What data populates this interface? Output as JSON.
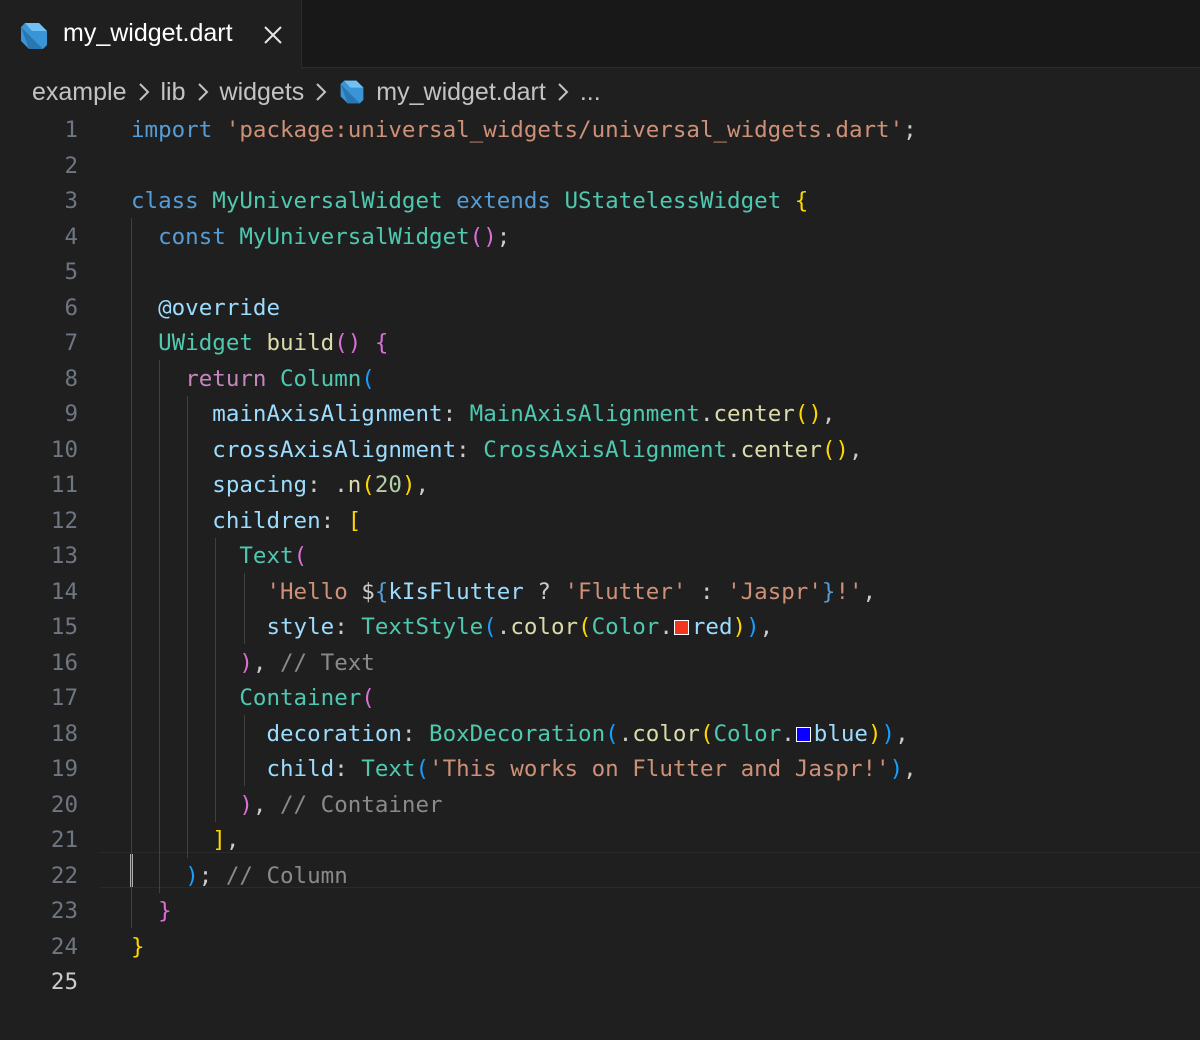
{
  "tab": {
    "label": "my_widget.dart"
  },
  "breadcrumb": {
    "items": [
      "example",
      "lib",
      "widgets",
      "my_widget.dart",
      "..."
    ]
  },
  "colors": {
    "red_swatch": "#f1351f",
    "blue_swatch": "#0b00ff"
  },
  "editor": {
    "line_numbers": [
      "1",
      "2",
      "3",
      "4",
      "5",
      "6",
      "7",
      "8",
      "9",
      "10",
      "11",
      "12",
      "13",
      "14",
      "15",
      "16",
      "17",
      "18",
      "19",
      "20",
      "21",
      "22",
      "23",
      "24",
      "25"
    ],
    "lines": [
      {
        "tokens": [
          {
            "t": "import",
            "c": "k"
          },
          {
            "t": " ",
            "c": "p"
          },
          {
            "t": "'package:universal_widgets/universal_widgets.dart'",
            "c": "s"
          },
          {
            "t": ";",
            "c": "p"
          }
        ]
      },
      {
        "tokens": []
      },
      {
        "tokens": [
          {
            "t": "class",
            "c": "k"
          },
          {
            "t": " ",
            "c": "p"
          },
          {
            "t": "MyUniversalWidget",
            "c": "t"
          },
          {
            "t": " ",
            "c": "p"
          },
          {
            "t": "extends",
            "c": "k"
          },
          {
            "t": " ",
            "c": "p"
          },
          {
            "t": "UStatelessWidget",
            "c": "t"
          },
          {
            "t": " ",
            "c": "p"
          },
          {
            "t": "{",
            "c": "b1"
          }
        ]
      },
      {
        "tokens": [
          {
            "t": "  ",
            "c": "p"
          },
          {
            "t": "const",
            "c": "k"
          },
          {
            "t": " ",
            "c": "p"
          },
          {
            "t": "MyUniversalWidget",
            "c": "t"
          },
          {
            "t": "()",
            "c": "b2"
          },
          {
            "t": ";",
            "c": "p"
          }
        ]
      },
      {
        "tokens": []
      },
      {
        "tokens": [
          {
            "t": "  ",
            "c": "p"
          },
          {
            "t": "@override",
            "c": "v"
          }
        ]
      },
      {
        "tokens": [
          {
            "t": "  ",
            "c": "p"
          },
          {
            "t": "UWidget",
            "c": "t"
          },
          {
            "t": " ",
            "c": "p"
          },
          {
            "t": "build",
            "c": "f"
          },
          {
            "t": "()",
            "c": "b2"
          },
          {
            "t": " ",
            "c": "p"
          },
          {
            "t": "{",
            "c": "b2"
          }
        ]
      },
      {
        "tokens": [
          {
            "t": "    ",
            "c": "p"
          },
          {
            "t": "return",
            "c": "kc"
          },
          {
            "t": " ",
            "c": "p"
          },
          {
            "t": "Column",
            "c": "t"
          },
          {
            "t": "(",
            "c": "b3"
          }
        ]
      },
      {
        "tokens": [
          {
            "t": "      ",
            "c": "p"
          },
          {
            "t": "mainAxisAlignment",
            "c": "v"
          },
          {
            "t": ": ",
            "c": "p"
          },
          {
            "t": "MainAxisAlignment",
            "c": "t"
          },
          {
            "t": ".",
            "c": "p"
          },
          {
            "t": "center",
            "c": "f"
          },
          {
            "t": "()",
            "c": "b1"
          },
          {
            "t": ",",
            "c": "p"
          }
        ]
      },
      {
        "tokens": [
          {
            "t": "      ",
            "c": "p"
          },
          {
            "t": "crossAxisAlignment",
            "c": "v"
          },
          {
            "t": ": ",
            "c": "p"
          },
          {
            "t": "CrossAxisAlignment",
            "c": "t"
          },
          {
            "t": ".",
            "c": "p"
          },
          {
            "t": "center",
            "c": "f"
          },
          {
            "t": "()",
            "c": "b1"
          },
          {
            "t": ",",
            "c": "p"
          }
        ]
      },
      {
        "tokens": [
          {
            "t": "      ",
            "c": "p"
          },
          {
            "t": "spacing",
            "c": "v"
          },
          {
            "t": ": .",
            "c": "p"
          },
          {
            "t": "n",
            "c": "f"
          },
          {
            "t": "(",
            "c": "b1"
          },
          {
            "t": "20",
            "c": "n"
          },
          {
            "t": ")",
            "c": "b1"
          },
          {
            "t": ",",
            "c": "p"
          }
        ]
      },
      {
        "tokens": [
          {
            "t": "      ",
            "c": "p"
          },
          {
            "t": "children",
            "c": "v"
          },
          {
            "t": ": ",
            "c": "p"
          },
          {
            "t": "[",
            "c": "b1"
          }
        ]
      },
      {
        "tokens": [
          {
            "t": "        ",
            "c": "p"
          },
          {
            "t": "Text",
            "c": "t"
          },
          {
            "t": "(",
            "c": "b2"
          }
        ]
      },
      {
        "tokens": [
          {
            "t": "          ",
            "c": "p"
          },
          {
            "t": "'Hello ",
            "c": "s"
          },
          {
            "t": "$",
            "c": "p"
          },
          {
            "t": "{",
            "c": "k"
          },
          {
            "t": "kIsFlutter",
            "c": "v"
          },
          {
            "t": " ? ",
            "c": "p"
          },
          {
            "t": "'Flutter'",
            "c": "s"
          },
          {
            "t": " : ",
            "c": "p"
          },
          {
            "t": "'Jaspr'",
            "c": "s"
          },
          {
            "t": "}",
            "c": "k"
          },
          {
            "t": "!'",
            "c": "s"
          },
          {
            "t": ",",
            "c": "p"
          }
        ]
      },
      {
        "tokens": [
          {
            "t": "          ",
            "c": "p"
          },
          {
            "t": "style",
            "c": "v"
          },
          {
            "t": ": ",
            "c": "p"
          },
          {
            "t": "TextStyle",
            "c": "t"
          },
          {
            "t": "(",
            "c": "b3"
          },
          {
            "t": ".",
            "c": "p"
          },
          {
            "t": "color",
            "c": "f"
          },
          {
            "t": "(",
            "c": "b1"
          },
          {
            "t": "Color",
            "c": "t"
          },
          {
            "t": ".",
            "c": "p"
          },
          {
            "t": "",
            "c": "swatch",
            "swatch": "red_swatch"
          },
          {
            "t": "red",
            "c": "v"
          },
          {
            "t": ")",
            "c": "b1"
          },
          {
            "t": ")",
            "c": "b3"
          },
          {
            "t": ",",
            "c": "p"
          }
        ]
      },
      {
        "tokens": [
          {
            "t": "        ",
            "c": "p"
          },
          {
            "t": ")",
            "c": "b2"
          },
          {
            "t": ", ",
            "c": "p"
          },
          {
            "t": "// Text",
            "c": "c"
          }
        ]
      },
      {
        "tokens": [
          {
            "t": "        ",
            "c": "p"
          },
          {
            "t": "Container",
            "c": "t"
          },
          {
            "t": "(",
            "c": "b2"
          }
        ]
      },
      {
        "tokens": [
          {
            "t": "          ",
            "c": "p"
          },
          {
            "t": "decoration",
            "c": "v"
          },
          {
            "t": ": ",
            "c": "p"
          },
          {
            "t": "BoxDecoration",
            "c": "t"
          },
          {
            "t": "(",
            "c": "b3"
          },
          {
            "t": ".",
            "c": "p"
          },
          {
            "t": "color",
            "c": "f"
          },
          {
            "t": "(",
            "c": "b1"
          },
          {
            "t": "Color",
            "c": "t"
          },
          {
            "t": ".",
            "c": "p"
          },
          {
            "t": "",
            "c": "swatch",
            "swatch": "blue_swatch"
          },
          {
            "t": "blue",
            "c": "v"
          },
          {
            "t": ")",
            "c": "b1"
          },
          {
            "t": ")",
            "c": "b3"
          },
          {
            "t": ",",
            "c": "p"
          }
        ]
      },
      {
        "tokens": [
          {
            "t": "          ",
            "c": "p"
          },
          {
            "t": "child",
            "c": "v"
          },
          {
            "t": ": ",
            "c": "p"
          },
          {
            "t": "Text",
            "c": "t"
          },
          {
            "t": "(",
            "c": "b3"
          },
          {
            "t": "'This works on Flutter and Jaspr!'",
            "c": "s"
          },
          {
            "t": ")",
            "c": "b3"
          },
          {
            "t": ",",
            "c": "p"
          }
        ]
      },
      {
        "tokens": [
          {
            "t": "        ",
            "c": "p"
          },
          {
            "t": ")",
            "c": "b2"
          },
          {
            "t": ", ",
            "c": "p"
          },
          {
            "t": "// Container",
            "c": "c"
          }
        ]
      },
      {
        "tokens": [
          {
            "t": "      ",
            "c": "p"
          },
          {
            "t": "]",
            "c": "b1"
          },
          {
            "t": ",",
            "c": "p"
          }
        ]
      },
      {
        "tokens": [
          {
            "t": "    ",
            "c": "p"
          },
          {
            "t": ")",
            "c": "b3"
          },
          {
            "t": "; ",
            "c": "p"
          },
          {
            "t": "// Column",
            "c": "c"
          }
        ]
      },
      {
        "tokens": [
          {
            "t": "  ",
            "c": "p"
          },
          {
            "t": "}",
            "c": "b2"
          }
        ]
      },
      {
        "tokens": [
          {
            "t": "}",
            "c": "b1"
          }
        ]
      },
      {
        "tokens": []
      }
    ],
    "active_line": 25
  }
}
